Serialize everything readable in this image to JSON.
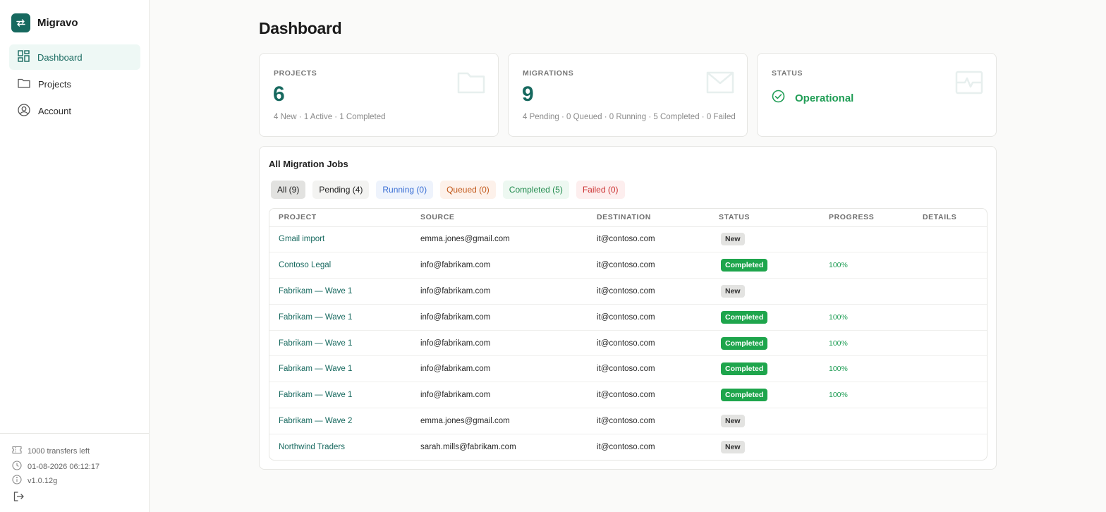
{
  "app": {
    "name": "Migravo"
  },
  "sidebar": {
    "items": [
      {
        "label": "Dashboard",
        "icon": "dashboard-icon",
        "active": true
      },
      {
        "label": "Projects",
        "icon": "folder-icon",
        "active": false
      },
      {
        "label": "Account",
        "icon": "user-circle-icon",
        "active": false
      }
    ],
    "footer": {
      "transfers": "1000 transfers left",
      "datetime": "01-08-2026 06:12:17",
      "version": "v1.0.12g"
    }
  },
  "page": {
    "title": "Dashboard"
  },
  "cards": {
    "projects": {
      "label": "PROJECTS",
      "value": "6",
      "sub": "4 New · 1 Active · 1 Completed"
    },
    "migrations": {
      "label": "MIGRATIONS",
      "value": "9",
      "sub": "4 Pending · 0 Queued · 0 Running · 5 Completed · 0 Failed"
    },
    "status": {
      "label": "STATUS",
      "value": "Operational"
    }
  },
  "jobs": {
    "title": "All Migration Jobs",
    "filters": [
      "All (9)",
      "Pending (4)",
      "Running (0)",
      "Queued (0)",
      "Completed (5)",
      "Failed (0)"
    ],
    "columns": [
      "PROJECT",
      "SOURCE",
      "DESTINATION",
      "STATUS",
      "PROGRESS",
      "DETAILS"
    ],
    "rows": [
      {
        "project": "Gmail import",
        "source": "emma.jones@gmail.com",
        "destination": "it@contoso.com",
        "status": "New",
        "progress": ""
      },
      {
        "project": "Contoso Legal",
        "source": "info@fabrikam.com",
        "destination": "it@contoso.com",
        "status": "Completed",
        "progress": "100%"
      },
      {
        "project": "Fabrikam — Wave 1",
        "source": "info@fabrikam.com",
        "destination": "it@contoso.com",
        "status": "New",
        "progress": ""
      },
      {
        "project": "Fabrikam — Wave 1",
        "source": "info@fabrikam.com",
        "destination": "it@contoso.com",
        "status": "Completed",
        "progress": "100%"
      },
      {
        "project": "Fabrikam — Wave 1",
        "source": "info@fabrikam.com",
        "destination": "it@contoso.com",
        "status": "Completed",
        "progress": "100%"
      },
      {
        "project": "Fabrikam — Wave 1",
        "source": "info@fabrikam.com",
        "destination": "it@contoso.com",
        "status": "Completed",
        "progress": "100%"
      },
      {
        "project": "Fabrikam — Wave 1",
        "source": "info@fabrikam.com",
        "destination": "it@contoso.com",
        "status": "Completed",
        "progress": "100%"
      },
      {
        "project": "Fabrikam — Wave 2",
        "source": "emma.jones@gmail.com",
        "destination": "it@contoso.com",
        "status": "New",
        "progress": ""
      },
      {
        "project": "Northwind Traders",
        "source": "sarah.mills@fabrikam.com",
        "destination": "it@contoso.com",
        "status": "New",
        "progress": ""
      }
    ]
  },
  "colors": {
    "accent": "#17695f",
    "success": "#1ea54c",
    "background": "#fafaf9"
  }
}
